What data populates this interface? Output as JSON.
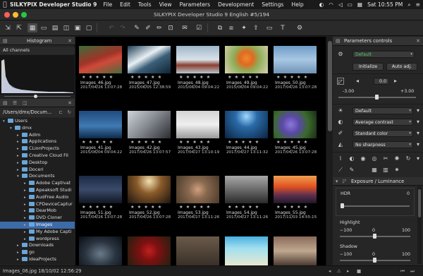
{
  "menubar": {
    "app": "SILKYPIX Developer Studio 9",
    "items": [
      "File",
      "Edit",
      "Tools",
      "View",
      "Parameters",
      "Development",
      "Settings",
      "Help"
    ],
    "clock": "Sat 10:55 PM"
  },
  "window": {
    "title": "SILKYPIX Developer Studio 9 English  #5/194"
  },
  "histogram": {
    "title": "Histogram",
    "channel": "All channels"
  },
  "browser": {
    "path": "/Users/dmx/Docum...",
    "folders": [
      {
        "label": "Users",
        "depth": 0,
        "open": true
      },
      {
        "label": "dmx",
        "depth": 1,
        "open": true
      },
      {
        "label": "Adlm",
        "depth": 2
      },
      {
        "label": "Applications",
        "depth": 2
      },
      {
        "label": "CLionProjects",
        "depth": 2
      },
      {
        "label": "Creative Cloud Fil",
        "depth": 2
      },
      {
        "label": "Desktop",
        "depth": 2
      },
      {
        "label": "Doceri",
        "depth": 2
      },
      {
        "label": "Documents",
        "depth": 2,
        "open": true
      },
      {
        "label": "Adobe Captivat",
        "depth": 3
      },
      {
        "label": "Apeaksoft Studi",
        "depth": 3
      },
      {
        "label": "AudFree Audio",
        "depth": 3
      },
      {
        "label": "CPDeviceCaptur",
        "depth": 3
      },
      {
        "label": "DearMob",
        "depth": 3
      },
      {
        "label": "DVD Cloner",
        "depth": 3
      },
      {
        "label": "Images",
        "depth": 3,
        "selected": true
      },
      {
        "label": "My Adobe Capti",
        "depth": 3
      },
      {
        "label": "wordpress",
        "depth": 3
      },
      {
        "label": "Downloads",
        "depth": 2
      },
      {
        "label": "go",
        "depth": 2
      },
      {
        "label": "IdeaProjects",
        "depth": 2
      }
    ]
  },
  "thumbnails": [
    {
      "name": "Images_46.jpg",
      "date": "2017/04/26 13:07:28",
      "stars": "★ ★ ★ ★ ★"
    },
    {
      "name": "Images_47.jpg",
      "date": "2015/06/05 12:38:59",
      "stars": "★ ★ ★ ★ ★"
    },
    {
      "name": "Images_48.jpg",
      "date": "2015/06/04 09:04:22",
      "stars": "★ ★ ★ ★ ★"
    },
    {
      "name": "Images_49.jpg",
      "date": "2015/06/04 09:04:22",
      "stars": "★ ★ ★ ★ ★"
    },
    {
      "name": "Images_50.jpg",
      "date": "2017/04/26 13:07:28",
      "stars": "★ ★ ★ ★ ★"
    },
    {
      "name": "Images_41.jpg",
      "date": "2015/06/04 09:04:22",
      "stars": "★ ★ ★ ★ ★"
    },
    {
      "name": "Images_42.jpg",
      "date": "2017/04/26 13:07:57",
      "stars": "★ ★ ★ ★ ★"
    },
    {
      "name": "Images_43.jpg",
      "date": "2017/04/27 13:10:19",
      "stars": "★ ★ ★ ★ ★"
    },
    {
      "name": "Images_44.jpg",
      "date": "2017/04/27 13:11:32",
      "stars": "★ ★ ★ ★ ★"
    },
    {
      "name": "Images_45.jpg",
      "date": "2017/04/26 13:07:28",
      "stars": "★ ★ ★ ★ ★"
    },
    {
      "name": "Images_51.jpg",
      "date": "2017/04/26 13:07:28",
      "stars": "★ ★ ★ ★ ★"
    },
    {
      "name": "Images_52.jpg",
      "date": "2017/04/26 13:07:28",
      "stars": "★ ★ ★ ★ ★"
    },
    {
      "name": "Images_53.jpg",
      "date": "2017/04/27 13:11:26",
      "stars": "★ ★ ★ ★ ★"
    },
    {
      "name": "Images_54.jpg",
      "date": "2017/04/27 13:11:26",
      "stars": "★ ★ ★ ★ ★"
    },
    {
      "name": "Images_55.jpg",
      "date": "2017/11/03 14:55:15",
      "stars": "★ ★ ★ ★ ★"
    },
    {
      "name": "",
      "date": "",
      "stars": ""
    },
    {
      "name": "",
      "date": "",
      "stars": ""
    },
    {
      "name": "",
      "date": "",
      "stars": ""
    },
    {
      "name": "",
      "date": "",
      "stars": ""
    },
    {
      "name": "",
      "date": "",
      "stars": ""
    }
  ],
  "controls": {
    "title": "Parameters controls",
    "preset": "Default",
    "initialize": "Initialize",
    "auto_adj": "Auto adj.",
    "exposure_value": "0.0",
    "exposure_min": "-3.00",
    "exposure_max": "+3.00",
    "white_balance": "Default",
    "contrast": "Average contrast",
    "color": "Standard color",
    "sharpness": "No sharpness",
    "section": "Exposure / Luminance",
    "hdr_label": "HDR",
    "hdr_value": "0",
    "highlight_label": "Highlight",
    "highlight_min": "−100",
    "highlight_mid": "0",
    "highlight_max": "100",
    "shadow_label": "Shadow",
    "shadow_min": "−100",
    "shadow_mid": "0",
    "shadow_max": "100"
  },
  "status": {
    "text": "Images_06.jpg 18/10/02 12:56:29"
  }
}
